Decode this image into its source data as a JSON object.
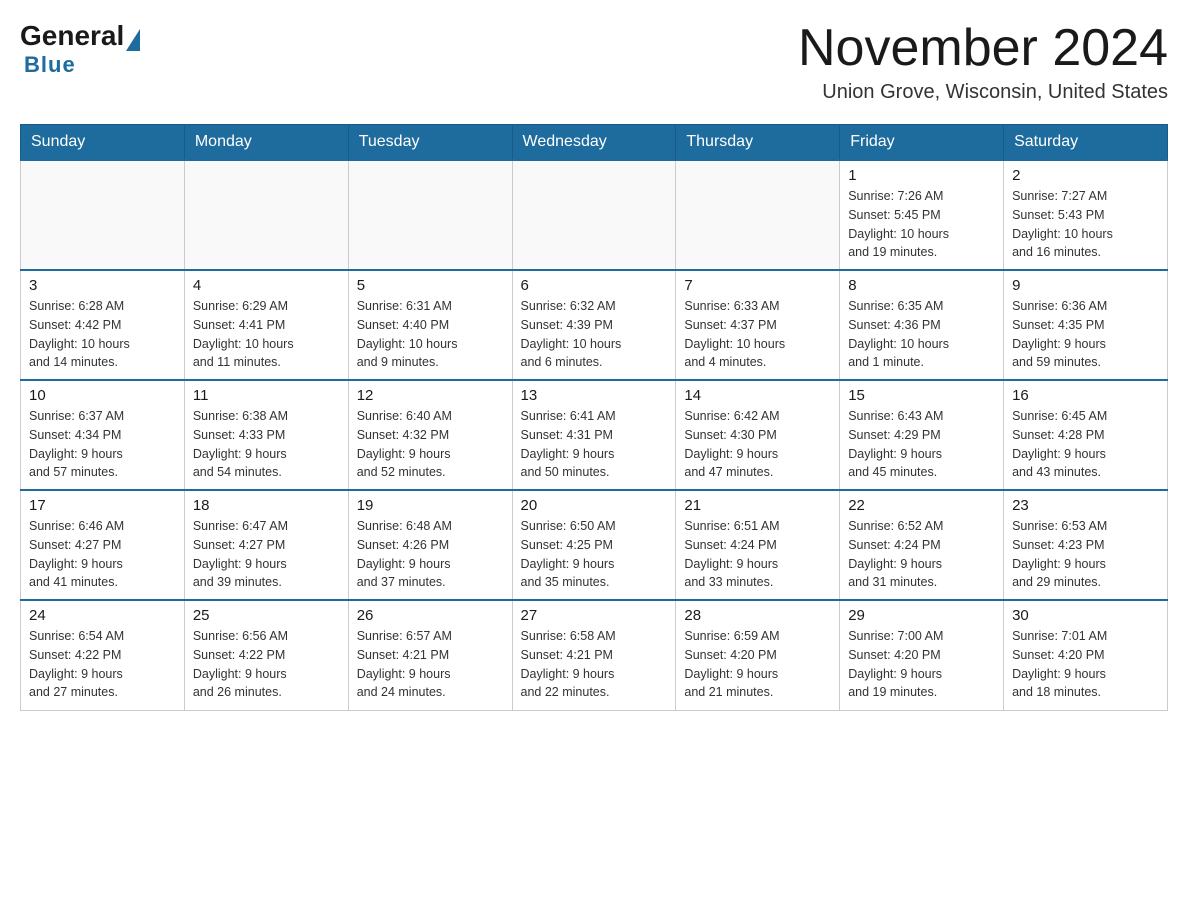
{
  "header": {
    "logo": {
      "general": "General",
      "blue": "Blue"
    },
    "title": "November 2024",
    "location": "Union Grove, Wisconsin, United States"
  },
  "days_of_week": [
    "Sunday",
    "Monday",
    "Tuesday",
    "Wednesday",
    "Thursday",
    "Friday",
    "Saturday"
  ],
  "weeks": [
    {
      "days": [
        {
          "number": "",
          "info": ""
        },
        {
          "number": "",
          "info": ""
        },
        {
          "number": "",
          "info": ""
        },
        {
          "number": "",
          "info": ""
        },
        {
          "number": "",
          "info": ""
        },
        {
          "number": "1",
          "info": "Sunrise: 7:26 AM\nSunset: 5:45 PM\nDaylight: 10 hours\nand 19 minutes."
        },
        {
          "number": "2",
          "info": "Sunrise: 7:27 AM\nSunset: 5:43 PM\nDaylight: 10 hours\nand 16 minutes."
        }
      ]
    },
    {
      "days": [
        {
          "number": "3",
          "info": "Sunrise: 6:28 AM\nSunset: 4:42 PM\nDaylight: 10 hours\nand 14 minutes."
        },
        {
          "number": "4",
          "info": "Sunrise: 6:29 AM\nSunset: 4:41 PM\nDaylight: 10 hours\nand 11 minutes."
        },
        {
          "number": "5",
          "info": "Sunrise: 6:31 AM\nSunset: 4:40 PM\nDaylight: 10 hours\nand 9 minutes."
        },
        {
          "number": "6",
          "info": "Sunrise: 6:32 AM\nSunset: 4:39 PM\nDaylight: 10 hours\nand 6 minutes."
        },
        {
          "number": "7",
          "info": "Sunrise: 6:33 AM\nSunset: 4:37 PM\nDaylight: 10 hours\nand 4 minutes."
        },
        {
          "number": "8",
          "info": "Sunrise: 6:35 AM\nSunset: 4:36 PM\nDaylight: 10 hours\nand 1 minute."
        },
        {
          "number": "9",
          "info": "Sunrise: 6:36 AM\nSunset: 4:35 PM\nDaylight: 9 hours\nand 59 minutes."
        }
      ]
    },
    {
      "days": [
        {
          "number": "10",
          "info": "Sunrise: 6:37 AM\nSunset: 4:34 PM\nDaylight: 9 hours\nand 57 minutes."
        },
        {
          "number": "11",
          "info": "Sunrise: 6:38 AM\nSunset: 4:33 PM\nDaylight: 9 hours\nand 54 minutes."
        },
        {
          "number": "12",
          "info": "Sunrise: 6:40 AM\nSunset: 4:32 PM\nDaylight: 9 hours\nand 52 minutes."
        },
        {
          "number": "13",
          "info": "Sunrise: 6:41 AM\nSunset: 4:31 PM\nDaylight: 9 hours\nand 50 minutes."
        },
        {
          "number": "14",
          "info": "Sunrise: 6:42 AM\nSunset: 4:30 PM\nDaylight: 9 hours\nand 47 minutes."
        },
        {
          "number": "15",
          "info": "Sunrise: 6:43 AM\nSunset: 4:29 PM\nDaylight: 9 hours\nand 45 minutes."
        },
        {
          "number": "16",
          "info": "Sunrise: 6:45 AM\nSunset: 4:28 PM\nDaylight: 9 hours\nand 43 minutes."
        }
      ]
    },
    {
      "days": [
        {
          "number": "17",
          "info": "Sunrise: 6:46 AM\nSunset: 4:27 PM\nDaylight: 9 hours\nand 41 minutes."
        },
        {
          "number": "18",
          "info": "Sunrise: 6:47 AM\nSunset: 4:27 PM\nDaylight: 9 hours\nand 39 minutes."
        },
        {
          "number": "19",
          "info": "Sunrise: 6:48 AM\nSunset: 4:26 PM\nDaylight: 9 hours\nand 37 minutes."
        },
        {
          "number": "20",
          "info": "Sunrise: 6:50 AM\nSunset: 4:25 PM\nDaylight: 9 hours\nand 35 minutes."
        },
        {
          "number": "21",
          "info": "Sunrise: 6:51 AM\nSunset: 4:24 PM\nDaylight: 9 hours\nand 33 minutes."
        },
        {
          "number": "22",
          "info": "Sunrise: 6:52 AM\nSunset: 4:24 PM\nDaylight: 9 hours\nand 31 minutes."
        },
        {
          "number": "23",
          "info": "Sunrise: 6:53 AM\nSunset: 4:23 PM\nDaylight: 9 hours\nand 29 minutes."
        }
      ]
    },
    {
      "days": [
        {
          "number": "24",
          "info": "Sunrise: 6:54 AM\nSunset: 4:22 PM\nDaylight: 9 hours\nand 27 minutes."
        },
        {
          "number": "25",
          "info": "Sunrise: 6:56 AM\nSunset: 4:22 PM\nDaylight: 9 hours\nand 26 minutes."
        },
        {
          "number": "26",
          "info": "Sunrise: 6:57 AM\nSunset: 4:21 PM\nDaylight: 9 hours\nand 24 minutes."
        },
        {
          "number": "27",
          "info": "Sunrise: 6:58 AM\nSunset: 4:21 PM\nDaylight: 9 hours\nand 22 minutes."
        },
        {
          "number": "28",
          "info": "Sunrise: 6:59 AM\nSunset: 4:20 PM\nDaylight: 9 hours\nand 21 minutes."
        },
        {
          "number": "29",
          "info": "Sunrise: 7:00 AM\nSunset: 4:20 PM\nDaylight: 9 hours\nand 19 minutes."
        },
        {
          "number": "30",
          "info": "Sunrise: 7:01 AM\nSunset: 4:20 PM\nDaylight: 9 hours\nand 18 minutes."
        }
      ]
    }
  ]
}
